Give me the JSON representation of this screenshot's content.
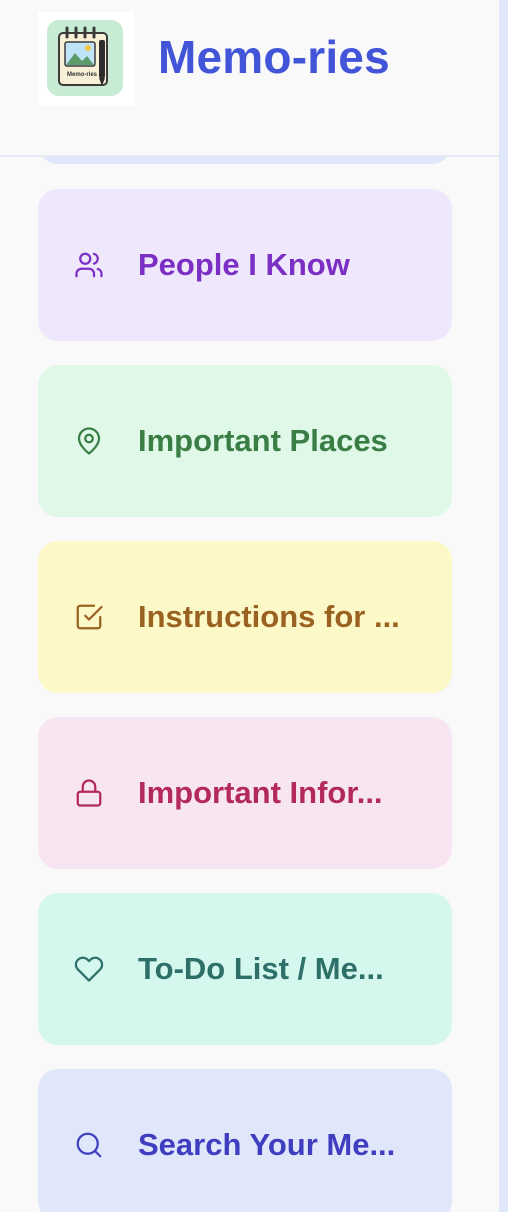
{
  "app": {
    "title": "Memo-ries",
    "logo_text": "Memo-ries"
  },
  "sidebar": {
    "items": [
      {
        "label": "People I Know",
        "icon": "users-icon",
        "bg": "#efe7fc",
        "color": "#7b2fc4"
      },
      {
        "label": "Important Places",
        "icon": "map-pin-icon",
        "bg": "#e0f8e8",
        "color": "#3a7d45"
      },
      {
        "label": "Instructions for ...",
        "icon": "checkbox-icon",
        "bg": "#fdf8c8",
        "color": "#9a6221"
      },
      {
        "label": "Important Infor...",
        "icon": "lock-icon",
        "bg": "#f7e6f1",
        "color": "#b32a5a"
      },
      {
        "label": "To-Do List / Me...",
        "icon": "heart-icon",
        "bg": "#d4f7ee",
        "color": "#2e6f6a"
      },
      {
        "label": "Search Your Me...",
        "icon": "search-icon",
        "bg": "#e1e7fb",
        "color": "#3f3ec0"
      }
    ]
  }
}
